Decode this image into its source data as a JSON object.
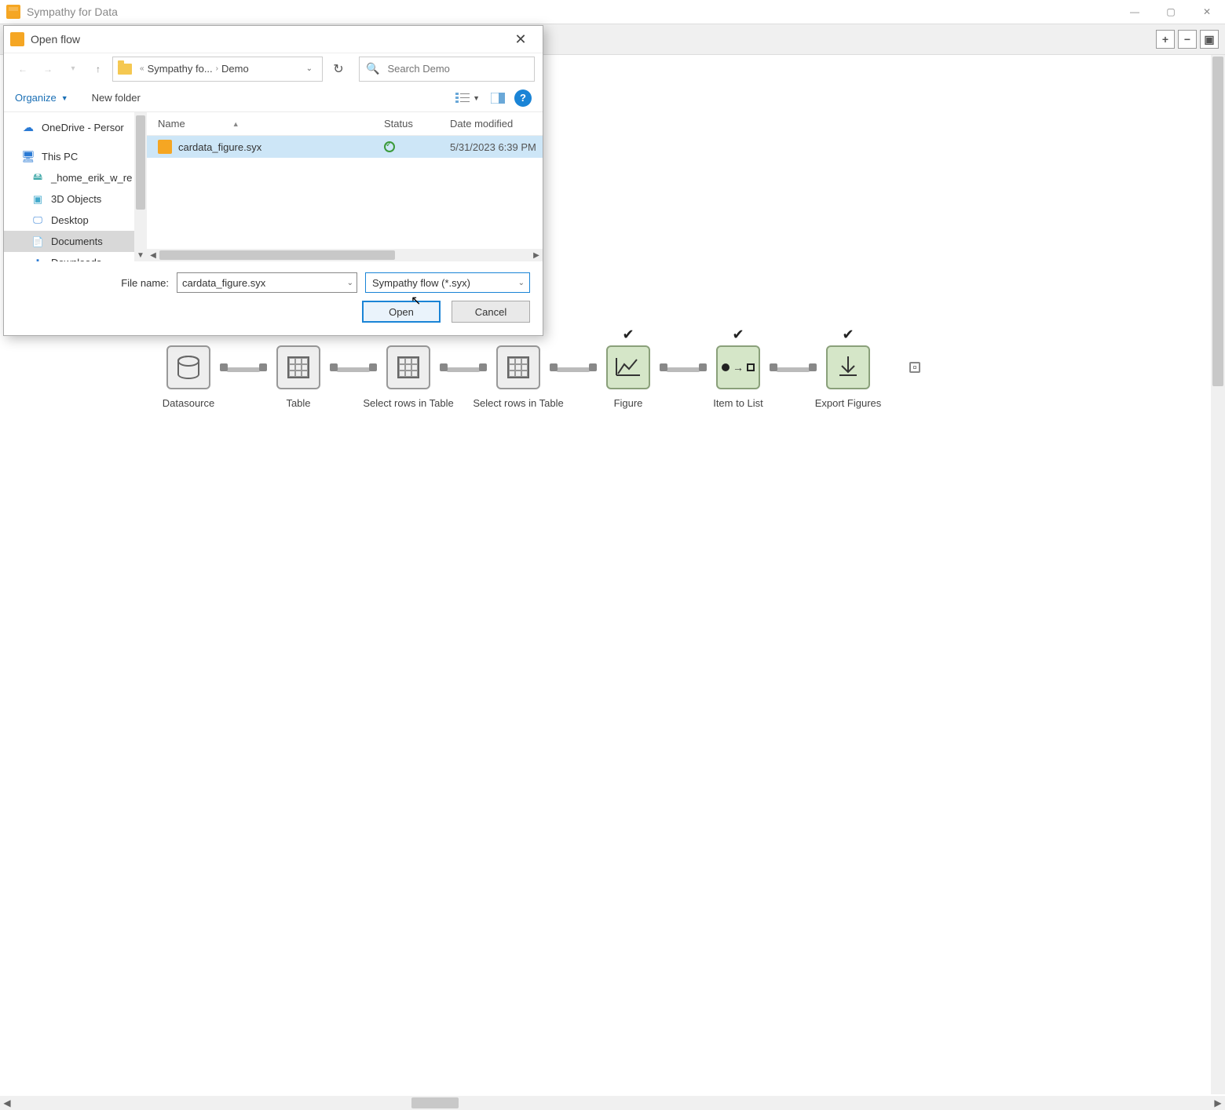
{
  "app": {
    "title": "Sympathy for Data"
  },
  "zoom_buttons": [
    "+",
    "−",
    "▣"
  ],
  "flow": {
    "nodes": [
      {
        "label": "Datasource",
        "type": "db",
        "checked": false
      },
      {
        "label": "Table",
        "type": "table",
        "checked": false
      },
      {
        "label": "Select rows in Table",
        "type": "table",
        "checked": false
      },
      {
        "label": "Select rows in Table",
        "type": "table",
        "checked": false
      },
      {
        "label": "Figure",
        "type": "fig",
        "checked": true
      },
      {
        "label": "Item to List",
        "type": "itl",
        "checked": true
      },
      {
        "label": "Export Figures",
        "type": "exp",
        "checked": true
      }
    ]
  },
  "dialog": {
    "title": "Open flow",
    "breadcrumb": {
      "prefix": "«",
      "parent": "Sympathy fo...",
      "current": "Demo"
    },
    "refresh_tooltip": "Refresh",
    "search_placeholder": "Search Demo",
    "toolbar": {
      "organize": "Organize",
      "new_folder": "New folder"
    },
    "tree": [
      {
        "label": "OneDrive - Persor",
        "icon": "cloud",
        "indent": 0
      },
      {
        "label": "This PC",
        "icon": "pc",
        "indent": 0
      },
      {
        "label": "_home_erik_w_re",
        "icon": "drive",
        "indent": 1
      },
      {
        "label": "3D Objects",
        "icon": "3d",
        "indent": 1
      },
      {
        "label": "Desktop",
        "icon": "desktop",
        "indent": 1
      },
      {
        "label": "Documents",
        "icon": "doc",
        "indent": 1,
        "selected": true
      },
      {
        "label": "Downloads",
        "icon": "dl",
        "indent": 1
      }
    ],
    "columns": {
      "name": "Name",
      "status": "Status",
      "date": "Date modified"
    },
    "files": [
      {
        "name": "cardata_figure.syx",
        "status": "ok",
        "date": "5/31/2023 6:39 PM",
        "selected": true
      }
    ],
    "footer": {
      "filename_label": "File name:",
      "filename_value": "cardata_figure.syx",
      "filter": "Sympathy flow (*.syx)",
      "open": "Open",
      "cancel": "Cancel"
    }
  }
}
